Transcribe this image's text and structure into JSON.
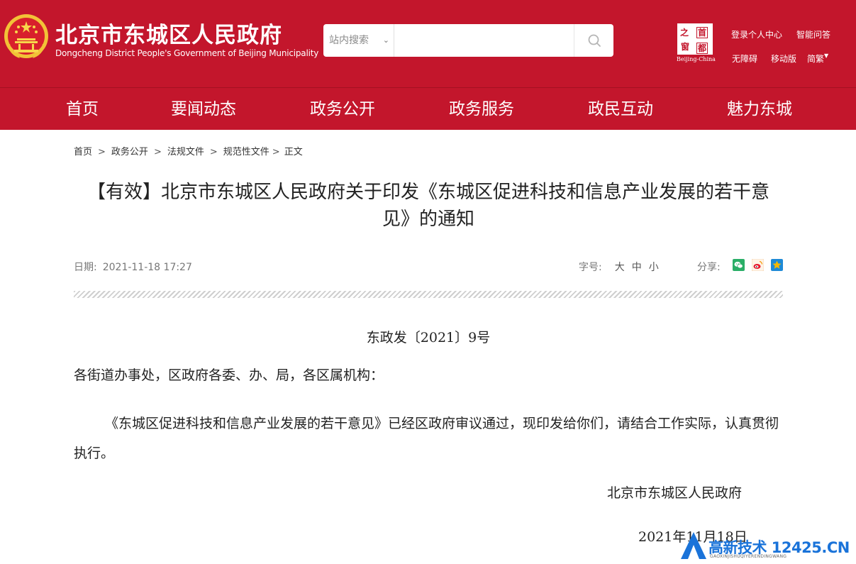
{
  "header": {
    "site_title": "北京市东城区人民政府",
    "site_subtitle": "Dongcheng District People's Government of Beijing Municipality",
    "search": {
      "scope_selected": "站内搜索",
      "placeholder": ""
    },
    "capital_logo": {
      "chars": [
        "之",
        "首",
        "窗",
        "都"
      ],
      "caption": "Beijing-China"
    },
    "links": {
      "login": "登录个人中心",
      "qa": "智能问答",
      "accessible": "无障碍",
      "mobile": "移动版",
      "language": "简繁"
    }
  },
  "nav": {
    "items": [
      "首页",
      "要闻动态",
      "政务公开",
      "政务服务",
      "政民互动",
      "魅力东城"
    ]
  },
  "breadcrumb": {
    "items": [
      "首页",
      "政务公开",
      "法规文件",
      "规范性文件"
    ],
    "current": "正文",
    "separator": ">"
  },
  "article": {
    "title": "【有效】北京市东城区人民政府关于印发《东城区促进科技和信息产业发展的若干意见》的通知",
    "date_label": "日期:",
    "date": "2021-11-18 17:27",
    "font_label": "字号:",
    "font_options": [
      "大",
      "中",
      "小"
    ],
    "share_label": "分享:",
    "doc_number": "东政发〔2021〕9号",
    "salutation": "各街道办事处，区政府各委、办、局，各区属机构：",
    "paragraph": "《东城区促进科技和信息产业发展的若干意见》已经区政府审议通过，现印发给你们，请结合工作实际，认真贯彻执行。",
    "signature_org": "北京市东城区人民政府",
    "signature_date": "2021年11月18日"
  },
  "watermark": {
    "text": "高新技术 12425.CN",
    "sub": "GAOXINJISHUQIYERENDINGWANG"
  },
  "colors": {
    "brand_red": "#c3162c",
    "wechat": "#2aae67",
    "weibo": "#e6162d",
    "qzone": "#f5b800"
  }
}
